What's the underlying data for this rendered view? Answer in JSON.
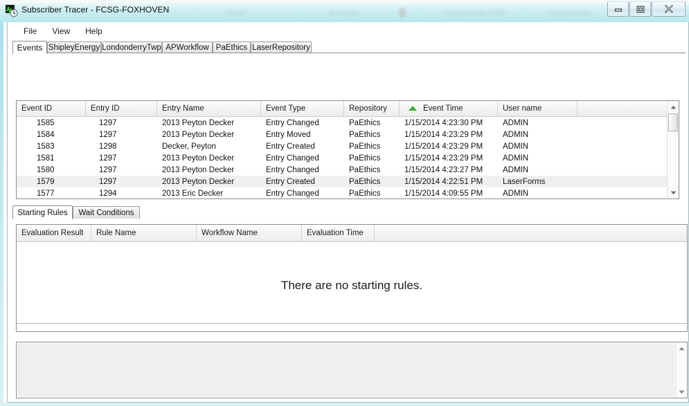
{
  "window": {
    "title": "Subscriber Tracer - FCSG-FOXHOVEN",
    "icon": "waveform-clock-icon",
    "minimize_label": "Minimize",
    "maximize_label": "Maximize",
    "close_label": "Close"
  },
  "menu": {
    "items": [
      {
        "label": "File"
      },
      {
        "label": "View"
      },
      {
        "label": "Help"
      }
    ]
  },
  "top_tabs": {
    "active_index": 0,
    "items": [
      {
        "label": "Events"
      },
      {
        "label": "ShipleyEnergy"
      },
      {
        "label": "LondonderryTwp"
      },
      {
        "label": "APWorkflow"
      },
      {
        "label": "PaEthics"
      },
      {
        "label": "LaserRepository"
      }
    ]
  },
  "events_grid": {
    "columns": [
      {
        "label": "Event ID"
      },
      {
        "label": "Entry ID"
      },
      {
        "label": "Entry Name"
      },
      {
        "label": "Event Type"
      },
      {
        "label": "Repository"
      },
      {
        "label": "Event Time",
        "sorted": "asc",
        "sort_icon": "sort-ascending-triangle-icon",
        "sort_color": "#2eb82e"
      },
      {
        "label": "User name"
      },
      {
        "label": ""
      }
    ],
    "rows": [
      {
        "selected": false,
        "cells": [
          "1585",
          "1297",
          "2013 Peyton Decker",
          "Entry Changed",
          "PaEthics",
          "1/15/2014 4:23:30 PM",
          "ADMIN",
          ""
        ]
      },
      {
        "selected": false,
        "cells": [
          "1584",
          "1297",
          "2013 Peyton Decker",
          "Entry Moved",
          "PaEthics",
          "1/15/2014 4:23:29 PM",
          "ADMIN",
          ""
        ]
      },
      {
        "selected": false,
        "cells": [
          "1583",
          "1298",
          "Decker, Peyton",
          "Entry Created",
          "PaEthics",
          "1/15/2014 4:23:29 PM",
          "ADMIN",
          ""
        ]
      },
      {
        "selected": false,
        "cells": [
          "1581",
          "1297",
          "2013 Peyton Decker",
          "Entry Changed",
          "PaEthics",
          "1/15/2014 4:23:29 PM",
          "ADMIN",
          ""
        ]
      },
      {
        "selected": false,
        "cells": [
          "1580",
          "1297",
          "2013 Peyton Decker",
          "Entry Changed",
          "PaEthics",
          "1/15/2014 4:23:27 PM",
          "ADMIN",
          ""
        ]
      },
      {
        "selected": true,
        "cells": [
          "1579",
          "1297",
          "2013 Peyton Decker",
          "Entry Created",
          "PaEthics",
          "1/15/2014 4:22:51 PM",
          "LaserForms",
          ""
        ]
      },
      {
        "selected": false,
        "cells": [
          "1577",
          "1294",
          "2013 Eric Decker",
          "Entry Changed",
          "PaEthics",
          "1/15/2014 4:09:55 PM",
          "ADMIN",
          ""
        ]
      }
    ],
    "scrollbar": {
      "up_icon": "scroll-up-arrow-icon",
      "down_icon": "scroll-down-arrow-icon"
    }
  },
  "bottom_tabs": {
    "active_index": 0,
    "items": [
      {
        "label": "Starting Rules"
      },
      {
        "label": "Wait Conditions"
      }
    ]
  },
  "rules_grid": {
    "columns": [
      {
        "label": "Evaluation Result"
      },
      {
        "label": "Rule Name"
      },
      {
        "label": "Workflow Name"
      },
      {
        "label": "Evaluation Time"
      },
      {
        "label": ""
      }
    ],
    "empty_message": "There are no starting rules.",
    "rows": []
  },
  "detail_pane": {
    "content": "",
    "scrollbar": {
      "up_icon": "scroll-up-arrow-icon",
      "down_icon": "scroll-down-arrow-icon"
    }
  },
  "colors": {
    "accent_glass": "#a9e2ea",
    "sort_green": "#2eb82e",
    "selection_gray": "#f0f0f0",
    "grid_border": "#8d8d8d"
  }
}
